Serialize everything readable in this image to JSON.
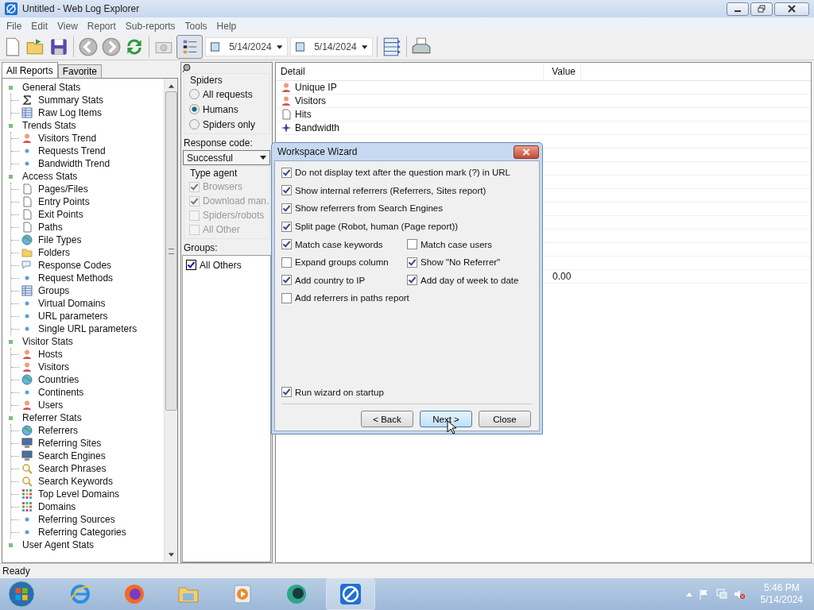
{
  "window": {
    "title": "Untitled - Web Log Explorer"
  },
  "menu": [
    "File",
    "Edit",
    "View",
    "Report",
    "Sub-reports",
    "Tools",
    "Help"
  ],
  "toolbar": {
    "date_from": "5/14/2024",
    "date_to": "5/14/2024"
  },
  "tabs": [
    {
      "label": "All Reports",
      "selected": true
    },
    {
      "label": "Favorite",
      "selected": false
    }
  ],
  "tree": [
    {
      "label": "General Stats",
      "children": [
        {
          "label": "Summary Stats",
          "kind": "sigma"
        },
        {
          "label": "Raw Log Items",
          "kind": "table"
        }
      ]
    },
    {
      "label": "Trends Stats",
      "children": [
        {
          "label": "Visitors Trend",
          "kind": "person"
        },
        {
          "label": "Requests Trend",
          "kind": "dot"
        },
        {
          "label": "Bandwidth Trend",
          "kind": "dot"
        }
      ]
    },
    {
      "label": "Access Stats",
      "children": [
        {
          "label": "Pages/Files",
          "kind": "page"
        },
        {
          "label": "Entry Points",
          "kind": "page"
        },
        {
          "label": "Exit Points",
          "kind": "page"
        },
        {
          "label": "Paths",
          "kind": "page"
        },
        {
          "label": "File Types",
          "kind": "globe"
        },
        {
          "label": "Folders",
          "kind": "folder"
        },
        {
          "label": "Response Codes",
          "kind": "bubble"
        },
        {
          "label": "Request Methods",
          "kind": "dot"
        },
        {
          "label": "Groups",
          "kind": "table"
        },
        {
          "label": "Virtual Domains",
          "kind": "dot"
        },
        {
          "label": "URL parameters",
          "kind": "dot"
        },
        {
          "label": "Single URL parameters",
          "kind": "dot"
        }
      ]
    },
    {
      "label": "Visitor Stats",
      "children": [
        {
          "label": "Hosts",
          "kind": "person"
        },
        {
          "label": "Visitors",
          "kind": "person"
        },
        {
          "label": "Countries",
          "kind": "globe"
        },
        {
          "label": "Continents",
          "kind": "dot"
        },
        {
          "label": "Users",
          "kind": "person"
        }
      ]
    },
    {
      "label": "Referrer Stats",
      "children": [
        {
          "label": "Referrers",
          "kind": "globe"
        },
        {
          "label": "Referring Sites",
          "kind": "monitor"
        },
        {
          "label": "Search Engines",
          "kind": "monitor"
        },
        {
          "label": "Search Phrases",
          "kind": "search"
        },
        {
          "label": "Search Keywords",
          "kind": "search"
        },
        {
          "label": "Top Level Domains",
          "kind": "grid"
        },
        {
          "label": "Domains",
          "kind": "grid"
        },
        {
          "label": "Referring Sources",
          "kind": "dot"
        },
        {
          "label": "Referring Categories",
          "kind": "dot"
        }
      ]
    },
    {
      "label": "User Agent Stats"
    }
  ],
  "filters": {
    "spiders_title": "Spiders",
    "spiders": [
      {
        "label": "All requests",
        "selected": false
      },
      {
        "label": "Humans",
        "selected": true
      },
      {
        "label": "Spiders only",
        "selected": false
      }
    ],
    "response_label": "Response code:",
    "response_value": "Successful",
    "agent_title": "Type agent",
    "agents": [
      {
        "label": "Browsers",
        "checked": true
      },
      {
        "label": "Download man.",
        "checked": true
      },
      {
        "label": "Spiders/robots",
        "checked": false
      },
      {
        "label": "All Other",
        "checked": false
      }
    ],
    "groups_label": "Groups:",
    "groups": [
      {
        "label": "All Others",
        "checked": true
      }
    ]
  },
  "table": {
    "columns": [
      "Detail",
      "Value"
    ],
    "rows": [
      {
        "detail": "Unique IP",
        "kind": "person"
      },
      {
        "detail": "Visitors",
        "kind": "person"
      },
      {
        "detail": "Hits",
        "kind": "page"
      },
      {
        "detail": "Bandwidth",
        "kind": "star"
      }
    ],
    "value_row": {
      "value": "0.00"
    }
  },
  "dialog": {
    "title": "Workspace Wizard",
    "options": [
      {
        "label": "Do not display text after the question mark (?) in URL",
        "checked": true
      },
      {
        "label": "Show internal referrers (Referrers, Sites report)",
        "checked": true
      },
      {
        "label": "Show referrers from Search Engines",
        "checked": true
      },
      {
        "label": "Split page (Robot, human (Page report))",
        "checked": true
      }
    ],
    "pairs": [
      {
        "label": "Match case keywords",
        "checked": true
      },
      {
        "label": "Match case users",
        "checked": false
      },
      {
        "label": "Expand groups column",
        "checked": false
      },
      {
        "label": "Show \"No Referrer\"",
        "checked": true
      },
      {
        "label": "Add country to IP",
        "checked": true
      },
      {
        "label": "Add day of week to date",
        "checked": true
      },
      {
        "label": "Add referrers in paths report",
        "checked": false
      }
    ],
    "startup": {
      "label": "Run wizard on startup",
      "checked": true
    },
    "buttons": [
      {
        "label": "< Back",
        "selected": false
      },
      {
        "label": "Next >",
        "selected": true
      },
      {
        "label": "Close",
        "selected": false
      }
    ]
  },
  "status_bar": "Ready",
  "taskbar": {
    "apps": [
      {
        "kind": "ie",
        "selected": false
      },
      {
        "kind": "firefox",
        "selected": false
      },
      {
        "kind": "folder",
        "selected": false
      },
      {
        "kind": "media",
        "selected": false
      },
      {
        "kind": "ball",
        "selected": false
      },
      {
        "kind": "app",
        "selected": true
      }
    ],
    "time": "5:46 PM",
    "date": "5/14/2024"
  }
}
